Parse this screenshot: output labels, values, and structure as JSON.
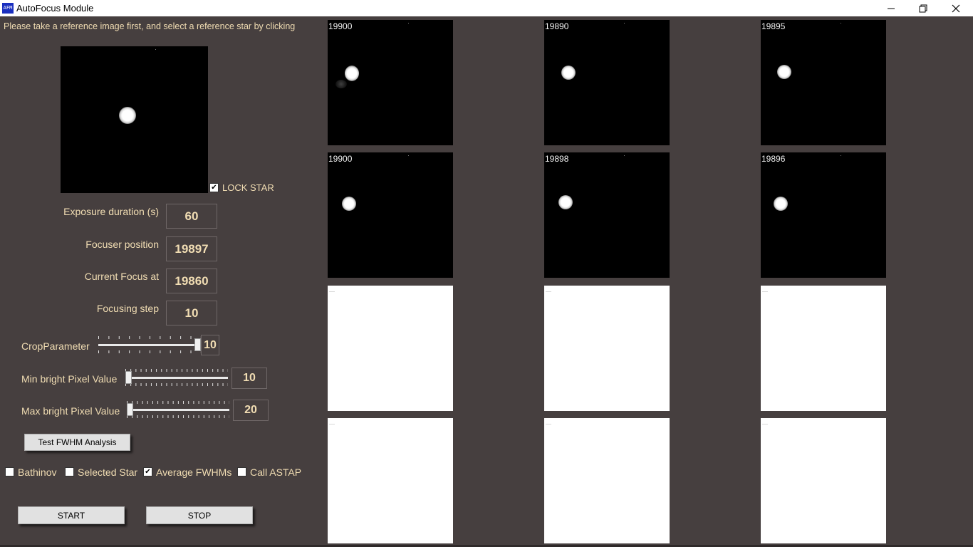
{
  "window": {
    "title": "AutoFocus Module",
    "icon_text": "AFM"
  },
  "instruction": "Please take a reference image first, and select a reference star by clicking",
  "lock_star": {
    "label": "LOCK STAR",
    "checked": true
  },
  "fields": {
    "exposure": {
      "label": "Exposure duration (s)",
      "value": "60"
    },
    "focuser_position": {
      "label": "Focuser position",
      "value": "19897"
    },
    "current_focus": {
      "label": "Current Focus at",
      "value": "19860"
    },
    "focusing_step": {
      "label": "Focusing step",
      "value": "10"
    }
  },
  "sliders": {
    "crop": {
      "label": "CropParameter",
      "value": "10",
      "position_fraction": 1.0
    },
    "min_bright": {
      "label": "Min bright Pixel Value",
      "value": "10",
      "position_fraction": 0.0
    },
    "max_bright": {
      "label": "Max bright Pixel Value",
      "value": "20",
      "position_fraction": 0.0
    }
  },
  "test_button": "Test FWHM Analysis",
  "options": {
    "bathinov": {
      "label": "Bathinov",
      "checked": false
    },
    "selected_star": {
      "label": "Selected Star",
      "checked": false
    },
    "average_fwhms": {
      "label": "Average FWHMs",
      "checked": true
    },
    "call_astap": {
      "label": "Call ASTAP",
      "checked": false
    }
  },
  "start_button": "START",
  "stop_button": "STOP",
  "tiles": [
    {
      "label": "19900"
    },
    {
      "label": "19890"
    },
    {
      "label": "19895"
    },
    {
      "label": "19900"
    },
    {
      "label": "19898"
    },
    {
      "label": "19896"
    }
  ],
  "colors": {
    "background": "#463f3f",
    "text": "#f1ddb3"
  }
}
